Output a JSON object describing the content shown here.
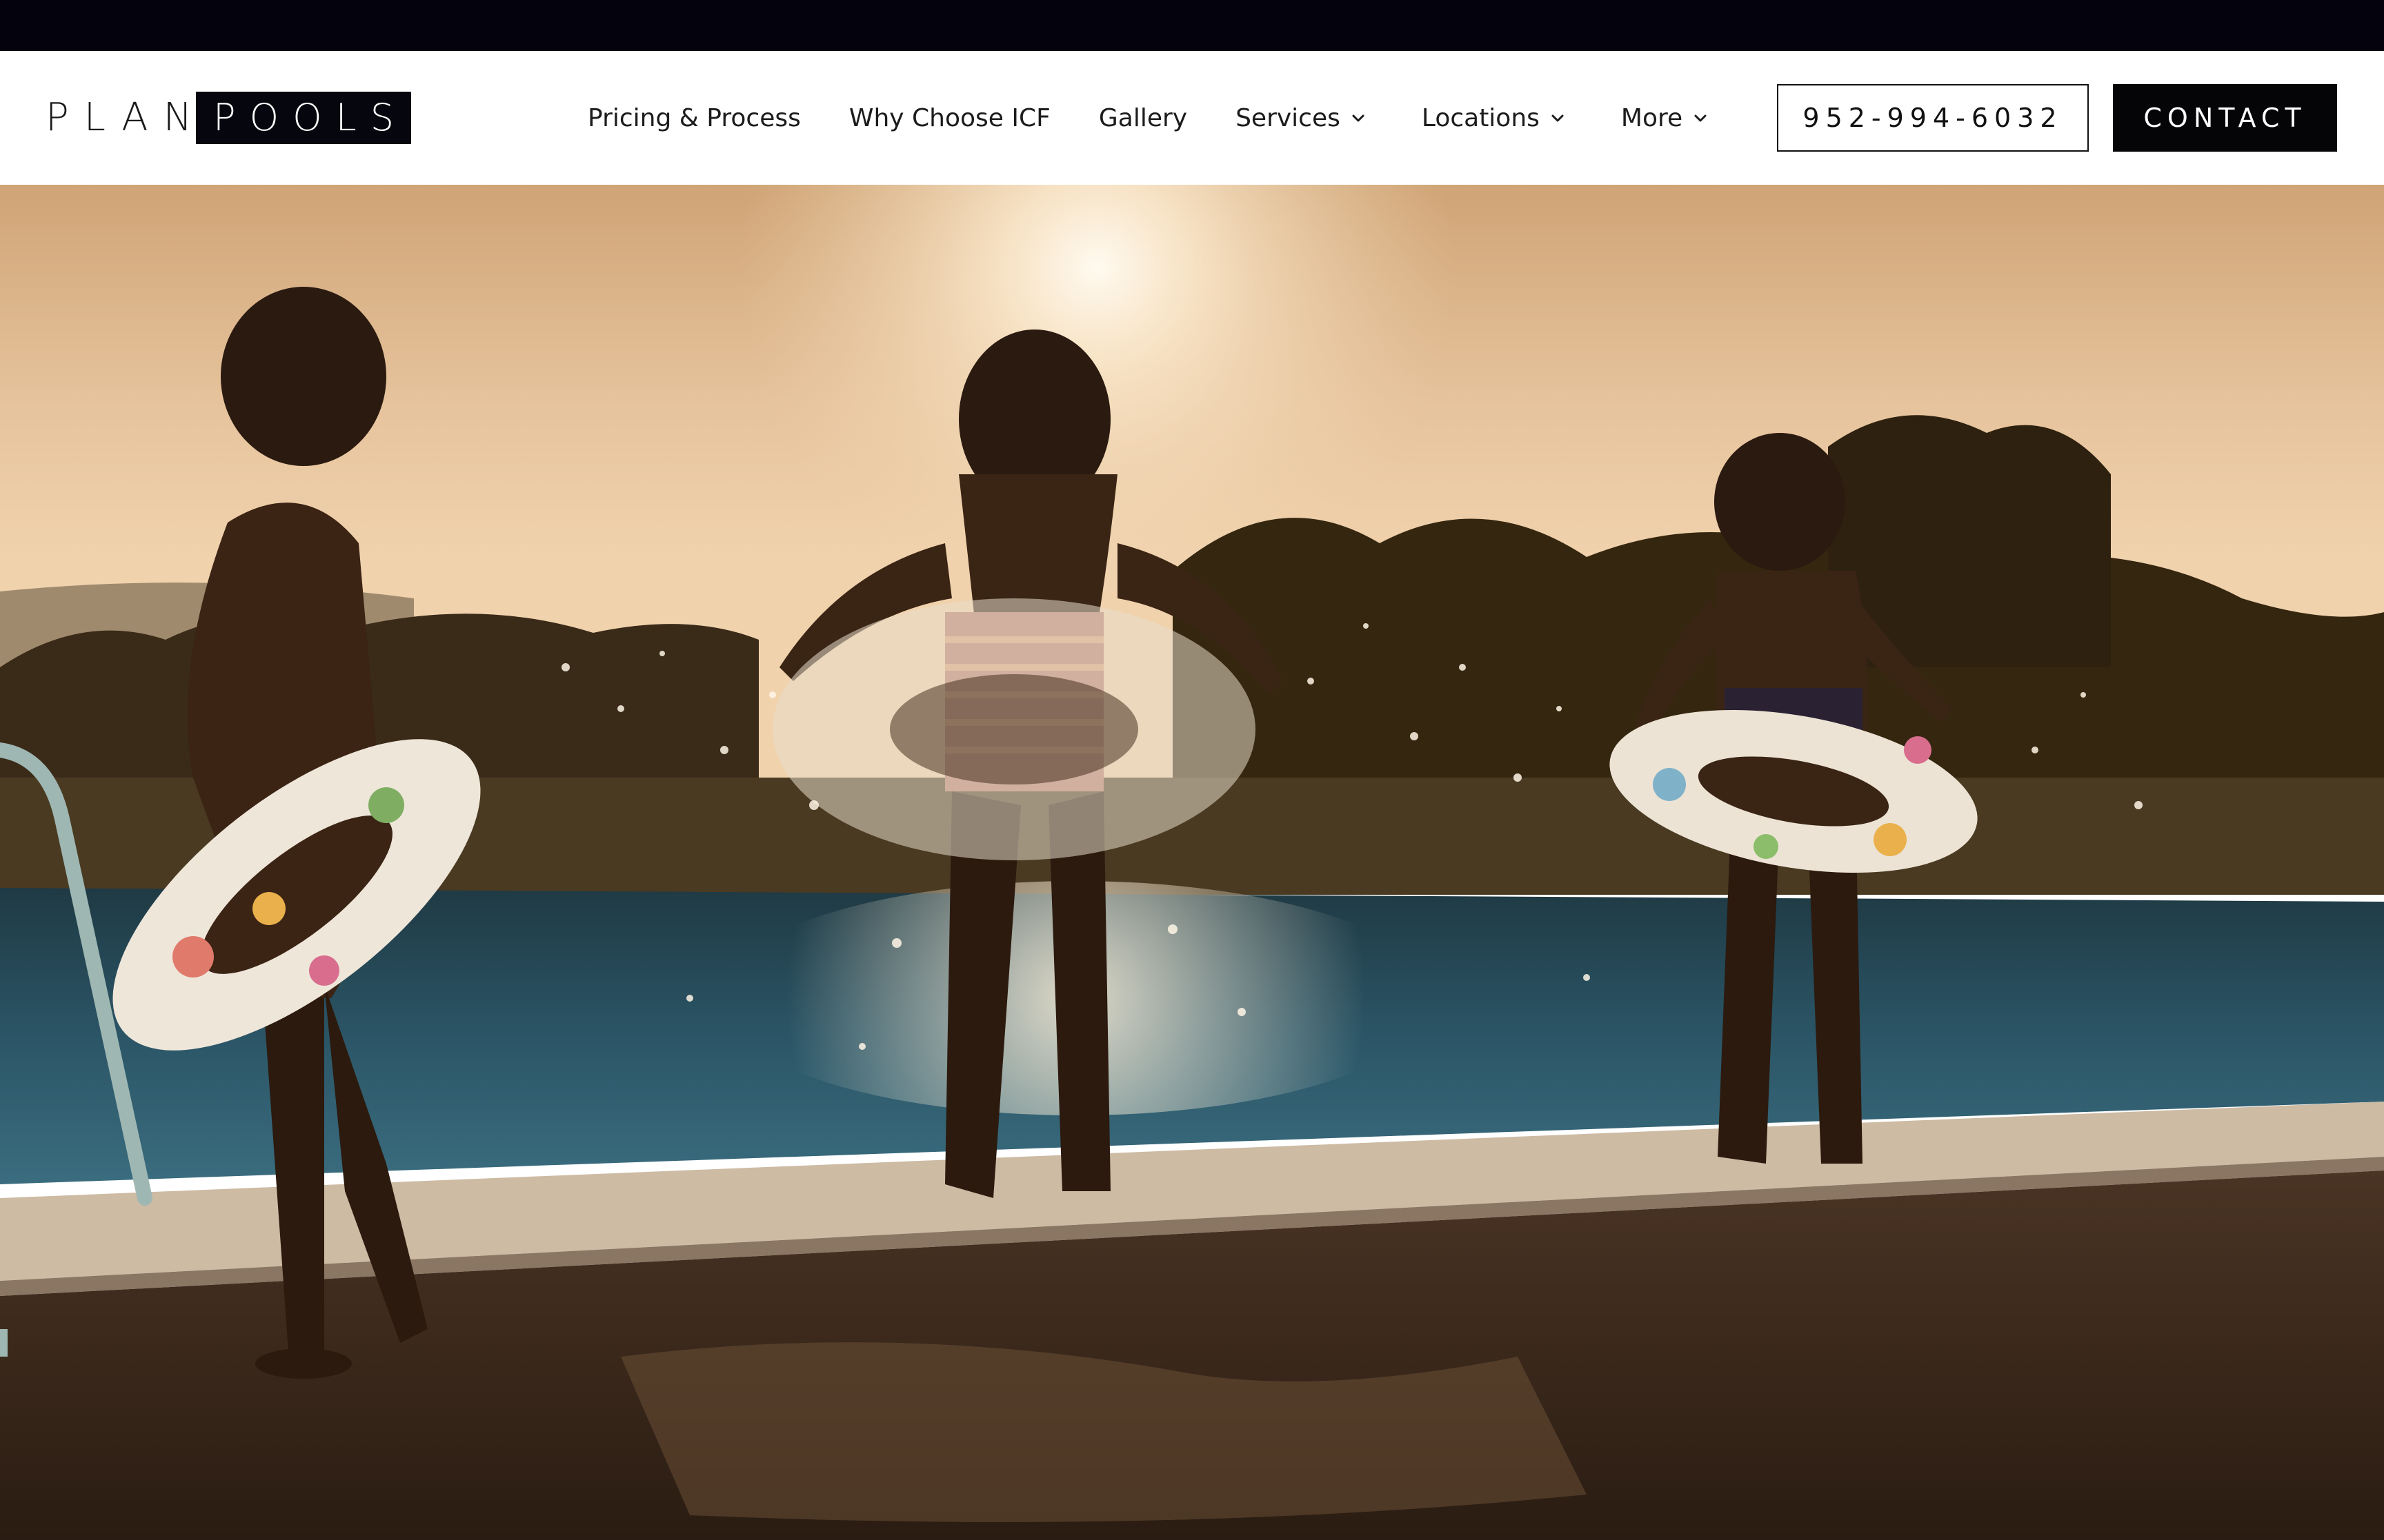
{
  "brand": {
    "logo_word_1": "PLAN",
    "logo_word_2": "POOLS"
  },
  "nav": {
    "items": [
      {
        "label": "Pricing & Process",
        "dropdown": false
      },
      {
        "label": "Why Choose ICF",
        "dropdown": false
      },
      {
        "label": "Gallery",
        "dropdown": false
      },
      {
        "label": "Services",
        "dropdown": true
      },
      {
        "label": "Locations",
        "dropdown": true
      },
      {
        "label": "More",
        "dropdown": true
      }
    ]
  },
  "cta": {
    "phone": "952-994-6032",
    "contact": "CONTACT"
  },
  "colors": {
    "topbar": "#03020d",
    "button_dark": "#050508",
    "text": "#1c1c1c"
  },
  "icons": {
    "dropdown": "chevron-down-icon"
  }
}
